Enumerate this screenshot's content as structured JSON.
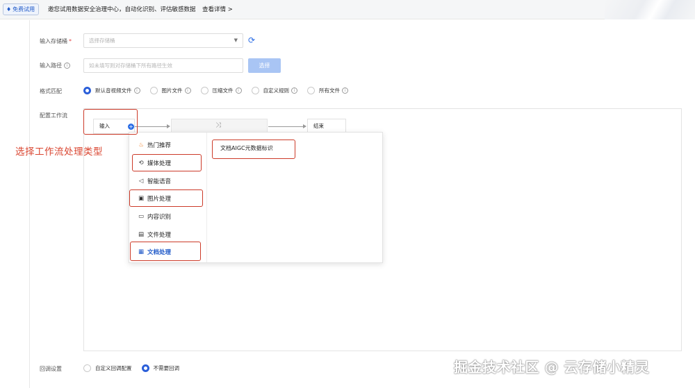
{
  "banner": {
    "badge": "免费试用",
    "text": "邀您试用数据安全治理中心，自动化识别、评估敏感数据",
    "link": "查看详情",
    "link_arrow": ">"
  },
  "form": {
    "bucket": {
      "label": "输入存储桶",
      "required_mark": "*",
      "placeholder": "选择存储桶"
    },
    "path": {
      "label": "输入路径",
      "placeholder": "如未填写则对存储桶下所有路径生效",
      "button": "选择"
    },
    "format": {
      "label": "格式匹配",
      "options": [
        "默认音视频文件",
        "图片文件",
        "压缩文件",
        "自定义规则",
        "所有文件"
      ],
      "selected": "默认音视频文件"
    },
    "workflow": {
      "label": "配置工作流"
    },
    "callback": {
      "label": "回调设置",
      "options": [
        "自定义回调配置",
        "不需要回调"
      ],
      "selected": "不需要回调"
    }
  },
  "workflow_nodes": {
    "input": "输入",
    "end": "结束"
  },
  "menu": {
    "categories": [
      {
        "label": "热门推荐",
        "icon": "flame-icon"
      },
      {
        "label": "媒体处理",
        "icon": "media-icon"
      },
      {
        "label": "智能语音",
        "icon": "speaker-icon"
      },
      {
        "label": "图片处理",
        "icon": "image-icon"
      },
      {
        "label": "内容识别",
        "icon": "video-icon"
      },
      {
        "label": "文件处理",
        "icon": "file-icon"
      },
      {
        "label": "文档处理",
        "icon": "document-icon"
      }
    ],
    "active": "文档处理",
    "sub_items": [
      "文档AIGC元数据标识"
    ]
  },
  "annotation": "选择工作流处理类型",
  "watermark": "掘金技术社区 @ 云存储小精灵",
  "colors": {
    "accent": "#2b5fd9",
    "highlight": "#cc3a28",
    "button_disabled": "#a9c5f4"
  }
}
